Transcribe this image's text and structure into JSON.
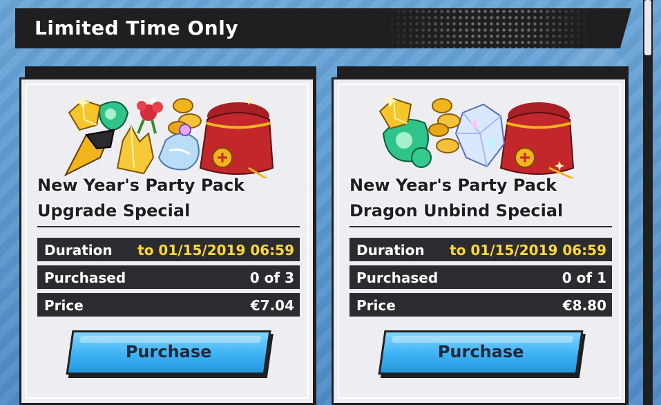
{
  "header": {
    "title": "Limited Time Only"
  },
  "packs": [
    {
      "title_line1": "New Year's Party Pack",
      "title_line2": "Upgrade Special",
      "duration_label": "Duration",
      "duration_value": "to 01/15/2019 06:59",
      "purchased_label": "Purchased",
      "purchased_value": "0 of 3",
      "price_label": "Price",
      "price_value": "€7.04",
      "button_label": "Purchase",
      "art_items": [
        "gold-crystal-icon",
        "green-dragon-orb-icon",
        "red-flower-icon",
        "gold-coins-icon",
        "red-treasure-bag-icon",
        "black-gold-horn-icon",
        "gold-crystal-cluster-icon",
        "blue-potion-bottle-icon"
      ]
    },
    {
      "title_line1": "New Year's Party Pack",
      "title_line2": "Dragon Unbind Special",
      "duration_label": "Duration",
      "duration_value": "to 01/15/2019 06:59",
      "purchased_label": "Purchased",
      "purchased_value": "0 of 1",
      "price_label": "Price",
      "price_value": "€8.80",
      "button_label": "Purchase",
      "art_items": [
        "gold-crystal-icon",
        "gold-coins-icon",
        "green-dragon-orb-icon",
        "rainbow-diamond-icon",
        "red-treasure-bag-icon"
      ]
    }
  ],
  "colors": {
    "accent_blue": "#3eb2f3",
    "dark": "#1f1f22",
    "date_yellow": "#ffd83a",
    "bag_red": "#c4272b",
    "gold": "#f1b51c"
  }
}
